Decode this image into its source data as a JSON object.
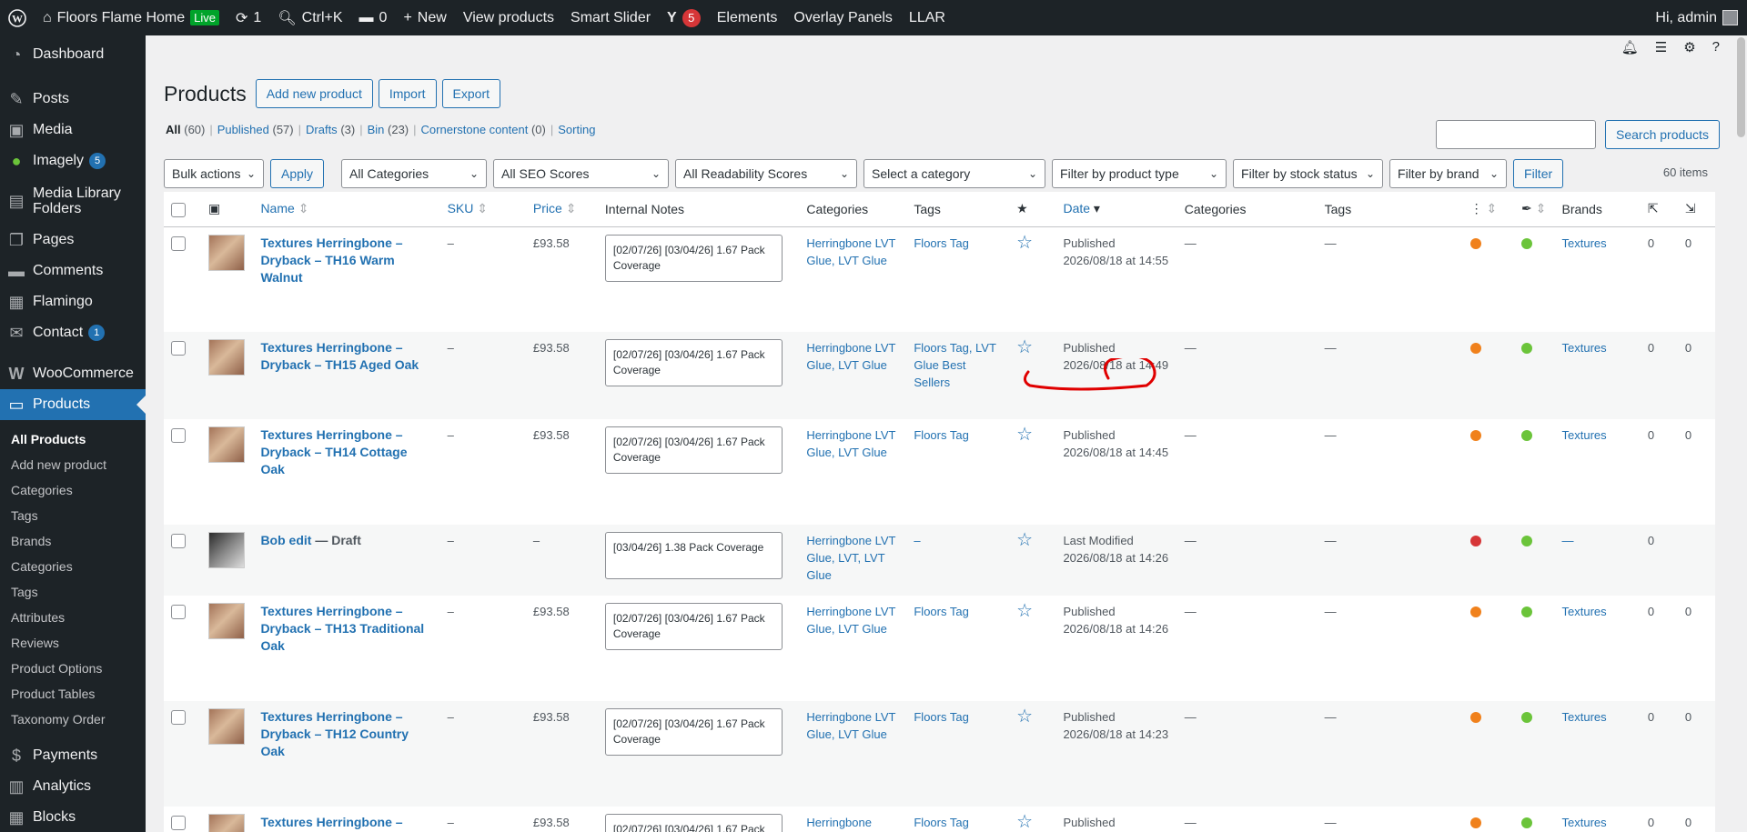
{
  "adminbar": {
    "site_name": "Floors Flame Home",
    "live_badge": "Live",
    "updates_count": "1",
    "search_shortcut": "Ctrl+K",
    "comments_count": "0",
    "new_label": "New",
    "view_products": "View products",
    "smart_slider": "Smart Slider",
    "yoast_count": "5",
    "elements": "Elements",
    "overlay_panels": "Overlay Panels",
    "llar": "LLAR",
    "greeting": "Hi, admin"
  },
  "sidebar": {
    "items": [
      {
        "label": "Dashboard",
        "icon": "dashboard-icon"
      },
      {
        "label": "Posts",
        "icon": "pin-icon"
      },
      {
        "label": "Media",
        "icon": "media-icon"
      },
      {
        "label": "Imagely",
        "icon": "imagely-icon",
        "badge": "5"
      },
      {
        "label": "Media Library Folders",
        "icon": "folder-icon"
      },
      {
        "label": "Pages",
        "icon": "pages-icon"
      },
      {
        "label": "Comments",
        "icon": "comment-icon"
      },
      {
        "label": "Flamingo",
        "icon": "flamingo-icon"
      },
      {
        "label": "Contact",
        "icon": "mail-icon",
        "badge": "1"
      },
      {
        "label": "WooCommerce",
        "icon": "woo-icon"
      },
      {
        "label": "Products",
        "icon": "products-icon"
      },
      {
        "label": "Payments",
        "icon": "payments-icon"
      },
      {
        "label": "Analytics",
        "icon": "analytics-icon"
      },
      {
        "label": "Blocks",
        "icon": "blocks-icon"
      }
    ],
    "submenu": [
      "All Products",
      "Add new product",
      "Categories",
      "Tags",
      "Brands",
      "Categories",
      "Tags",
      "Attributes",
      "Reviews",
      "Product Options",
      "Product Tables",
      "Taxonomy Order"
    ]
  },
  "page": {
    "title": "Products",
    "add_new": "Add new product",
    "import": "Import",
    "export": "Export",
    "views": [
      {
        "label": "All",
        "count": "(60)"
      },
      {
        "label": "Published",
        "count": "(57)"
      },
      {
        "label": "Drafts",
        "count": "(3)"
      },
      {
        "label": "Bin",
        "count": "(23)"
      },
      {
        "label": "Cornerstone content",
        "count": "(0)"
      },
      {
        "label": "Sorting",
        "count": ""
      }
    ],
    "search_button": "Search products",
    "items_count": "60 items"
  },
  "filters": {
    "bulk_actions": "Bulk actions",
    "apply": "Apply",
    "all_categories": "All Categories",
    "seo_scores": "All SEO Scores",
    "readability": "All Readability Scores",
    "select_category": "Select a category",
    "product_type": "Filter by product type",
    "stock_status": "Filter by stock status",
    "brand": "Filter by brand",
    "filter": "Filter"
  },
  "columns": {
    "name": "Name",
    "sku": "SKU",
    "price": "Price",
    "notes": "Internal Notes",
    "categories": "Categories",
    "tags": "Tags",
    "date": "Date",
    "categories2": "Categories",
    "tags2": "Tags",
    "brands": "Brands"
  },
  "rows": [
    {
      "name": "Textures Herringbone – Dryback – TH16 Warm Walnut",
      "sku": "–",
      "price": "£93.58",
      "notes": "[02/07/26] [03/04/26] 1.67 Pack Coverage",
      "categories": "Herringbone LVT Glue, LVT Glue",
      "tags": "Floors Tag",
      "date": "Published 2026/08/18 at 14:55",
      "cat2": "—",
      "tag2": "—",
      "seo": "#f0811c",
      "read": "#6bc43a",
      "brand": "Textures",
      "n1": "0",
      "n2": "0"
    },
    {
      "name": "Textures Herringbone – Dryback – TH15 Aged Oak",
      "sku": "–",
      "price": "£93.58",
      "notes": "[02/07/26] [03/04/26] 1.67 Pack Coverage",
      "categories": "Herringbone LVT Glue, LVT Glue",
      "tags": "Floors Tag, LVT Glue Best Sellers",
      "date": "Published 2026/08/18 at 14:49",
      "cat2": "—",
      "tag2": "—",
      "seo": "#f0811c",
      "read": "#6bc43a",
      "brand": "Textures",
      "n1": "0",
      "n2": "0"
    },
    {
      "name": "Textures Herringbone – Dryback – TH14 Cottage Oak",
      "sku": "–",
      "price": "£93.58",
      "notes": "[02/07/26] [03/04/26] 1.67 Pack Coverage",
      "categories": "Herringbone LVT Glue, LVT Glue",
      "tags": "Floors Tag",
      "date": "Published 2026/08/18 at 14:45",
      "cat2": "—",
      "tag2": "—",
      "seo": "#f0811c",
      "read": "#6bc43a",
      "brand": "Textures",
      "n1": "0",
      "n2": "0"
    },
    {
      "name": "Bob edit",
      "status": " — Draft",
      "sku": "–",
      "price": "–",
      "notes": "[03/04/26] 1.38 Pack Coverage",
      "categories": "Herringbone LVT Glue, LVT, LVT Glue",
      "tags": "–",
      "date": "Last Modified 2026/08/18 at 14:26",
      "cat2": "—",
      "tag2": "—",
      "seo": "#d63638",
      "read": "#6bc43a",
      "brand": "—",
      "n1": "0",
      "n2": ""
    },
    {
      "name": "Textures Herringbone – Dryback – TH13 Traditional Oak",
      "sku": "–",
      "price": "£93.58",
      "notes": "[02/07/26] [03/04/26] 1.67 Pack Coverage",
      "categories": "Herringbone LVT Glue, LVT Glue",
      "tags": "Floors Tag",
      "date": "Published 2026/08/18 at 14:26",
      "cat2": "—",
      "tag2": "—",
      "seo": "#f0811c",
      "read": "#6bc43a",
      "brand": "Textures",
      "n1": "0",
      "n2": "0"
    },
    {
      "name": "Textures Herringbone – Dryback – TH12 Country Oak",
      "sku": "–",
      "price": "£93.58",
      "notes": "[02/07/26] [03/04/26] 1.67 Pack Coverage",
      "categories": "Herringbone LVT Glue, LVT Glue",
      "tags": "Floors Tag",
      "date": "Published 2026/08/18 at 14:23",
      "cat2": "—",
      "tag2": "—",
      "seo": "#f0811c",
      "read": "#6bc43a",
      "brand": "Textures",
      "n1": "0",
      "n2": "0"
    },
    {
      "name": "Textures Herringbone –",
      "sku": "–",
      "price": "£93.58",
      "notes": "[02/07/26] [03/04/26] 1.67 Pack",
      "categories": "Herringbone",
      "tags": "Floors Tag",
      "date": "Published",
      "cat2": "—",
      "tag2": "—",
      "seo": "#f0811c",
      "read": "#6bc43a",
      "brand": "Textures",
      "n1": "0",
      "n2": "0"
    }
  ]
}
